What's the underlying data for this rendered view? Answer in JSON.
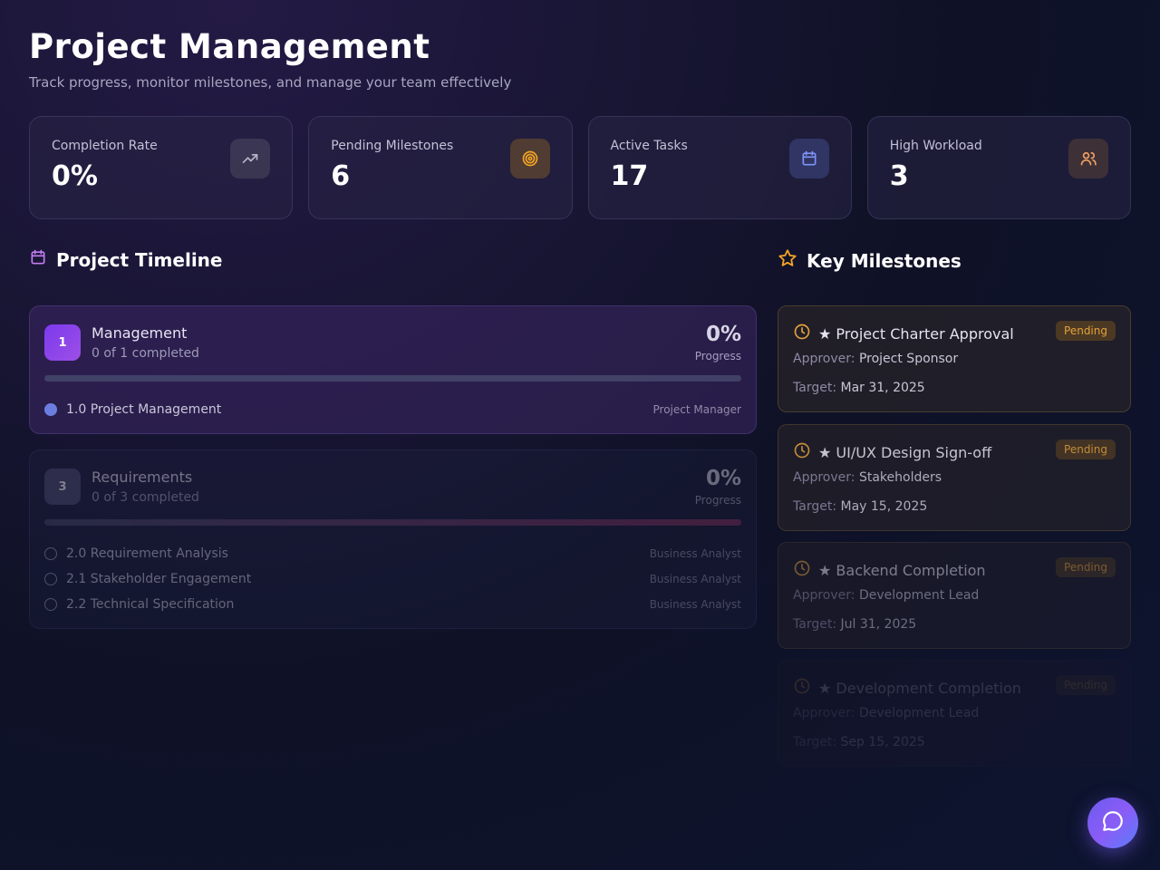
{
  "header": {
    "title": "Project Management",
    "subtitle": "Track progress, monitor milestones, and manage your team effectively"
  },
  "stats": [
    {
      "label": "Completion Rate",
      "value": "0%",
      "icon": "trending-up-icon"
    },
    {
      "label": "Pending Milestones",
      "value": "6",
      "icon": "target-icon"
    },
    {
      "label": "Active Tasks",
      "value": "17",
      "icon": "calendar-icon"
    },
    {
      "label": "High Workload",
      "value": "3",
      "icon": "users-icon"
    }
  ],
  "timeline": {
    "title": "Project Timeline",
    "phases": [
      {
        "number": "1",
        "name": "Management",
        "completed": "0 of 1 completed",
        "percent": "0%",
        "percent_label": "Progress",
        "progress": 0,
        "tasks": [
          {
            "name": "1.0 Project Management",
            "role": "Project Manager"
          }
        ]
      },
      {
        "number": "3",
        "name": "Requirements",
        "completed": "0 of 3 completed",
        "percent": "0%",
        "percent_label": "Progress",
        "progress": 0,
        "tasks": [
          {
            "name": "2.0 Requirement Analysis",
            "role": "Business Analyst"
          },
          {
            "name": "2.1 Stakeholder Engagement",
            "role": "Business Analyst"
          },
          {
            "name": "2.2 Technical Specification",
            "role": "Business Analyst"
          }
        ]
      }
    ]
  },
  "milestones": {
    "title": "Key Milestones",
    "approver_key": "Approver:",
    "target_key": "Target:",
    "items": [
      {
        "title": "★ Project Charter Approval",
        "status": "Pending",
        "approver": "Project Sponsor",
        "target": "Mar 31, 2025"
      },
      {
        "title": "★ UI/UX Design Sign-off",
        "status": "Pending",
        "approver": "Stakeholders",
        "target": "May 15, 2025"
      },
      {
        "title": "★ Backend Completion",
        "status": "Pending",
        "approver": "Development Lead",
        "target": "Jul 31, 2025"
      },
      {
        "title": "★ Development Completion",
        "status": "Pending",
        "approver": "Development Lead",
        "target": "Sep 15, 2025"
      }
    ]
  },
  "colors": {
    "accent_purple": "#7c3aed",
    "accent_amber": "#f59e0b",
    "accent_blue": "#6b82f0"
  }
}
